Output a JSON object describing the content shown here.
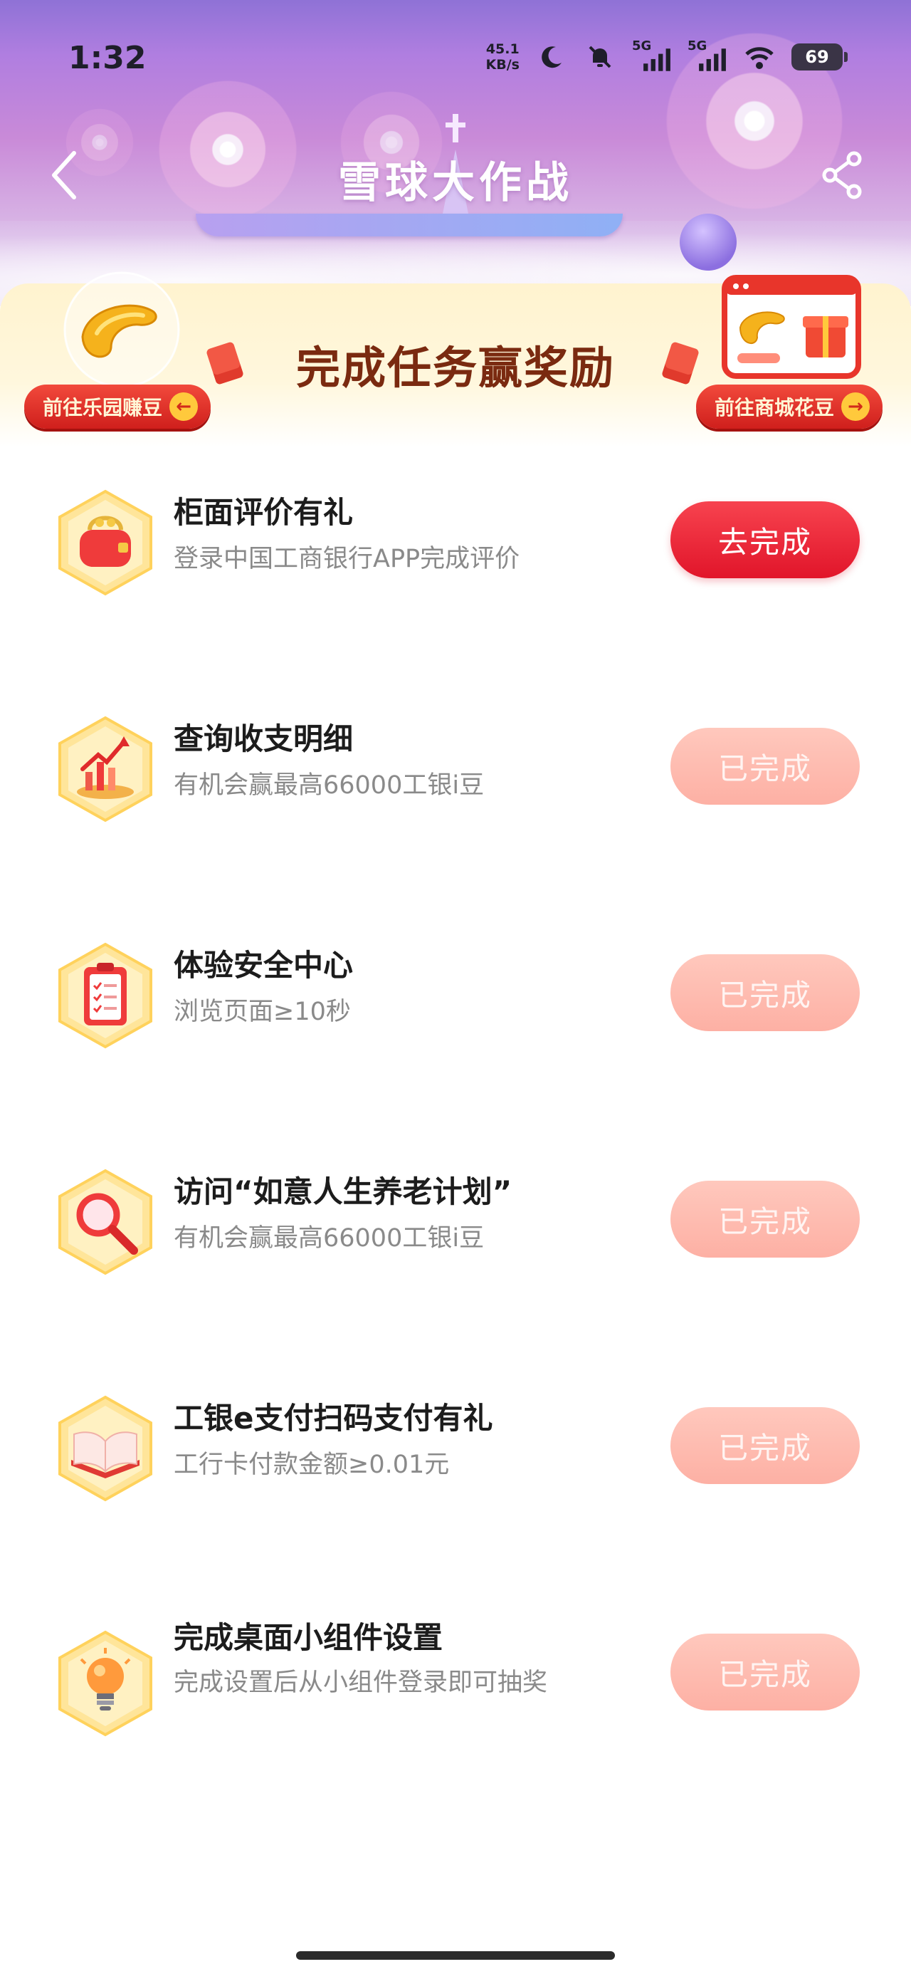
{
  "status_bar": {
    "time": "1:32",
    "net_speed_value": "45.1",
    "net_speed_unit": "KB/s",
    "signal_label_1": "5G",
    "signal_label_2": "5G",
    "battery": "69"
  },
  "nav": {
    "title": "雪球大作战",
    "back_icon": "chevron-left-icon",
    "share_icon": "share-icon"
  },
  "banner": {
    "title": "完成任务赢奖励",
    "left_button": "前往乐园赚豆",
    "right_button": "前往商城花豆"
  },
  "tasks": [
    {
      "title": "柜面评价有礼",
      "desc": "登录中国工商银行APP完成评价",
      "button": "去完成",
      "status": "active",
      "icon": "purse-icon"
    },
    {
      "title": "查询收支明细",
      "desc": "有机会赢最高66000工银i豆",
      "button": "已完成",
      "status": "done",
      "icon": "chart-icon"
    },
    {
      "title": "体验安全中心",
      "desc": "浏览页面≥10秒",
      "button": "已完成",
      "status": "done",
      "icon": "clipboard-icon"
    },
    {
      "title": "访问“如意人生养老计划”",
      "desc": "有机会赢最高66000工银i豆",
      "button": "已完成",
      "status": "done",
      "icon": "magnifier-icon"
    },
    {
      "title": "工银e支付扫码支付有礼",
      "desc": "工行卡付款金额≥0.01元",
      "button": "已完成",
      "status": "done",
      "icon": "book-icon"
    },
    {
      "title": "完成桌面小组件设置",
      "desc": "完成设置后从小组件登录即可抽奖",
      "button": "已完成",
      "status": "done",
      "icon": "lightbulb-icon"
    }
  ],
  "colors": {
    "active_button": "#e1152a",
    "done_button": "#fdb0a4",
    "banner_title": "#7a2a10",
    "header_purple": "#b07ee0"
  }
}
